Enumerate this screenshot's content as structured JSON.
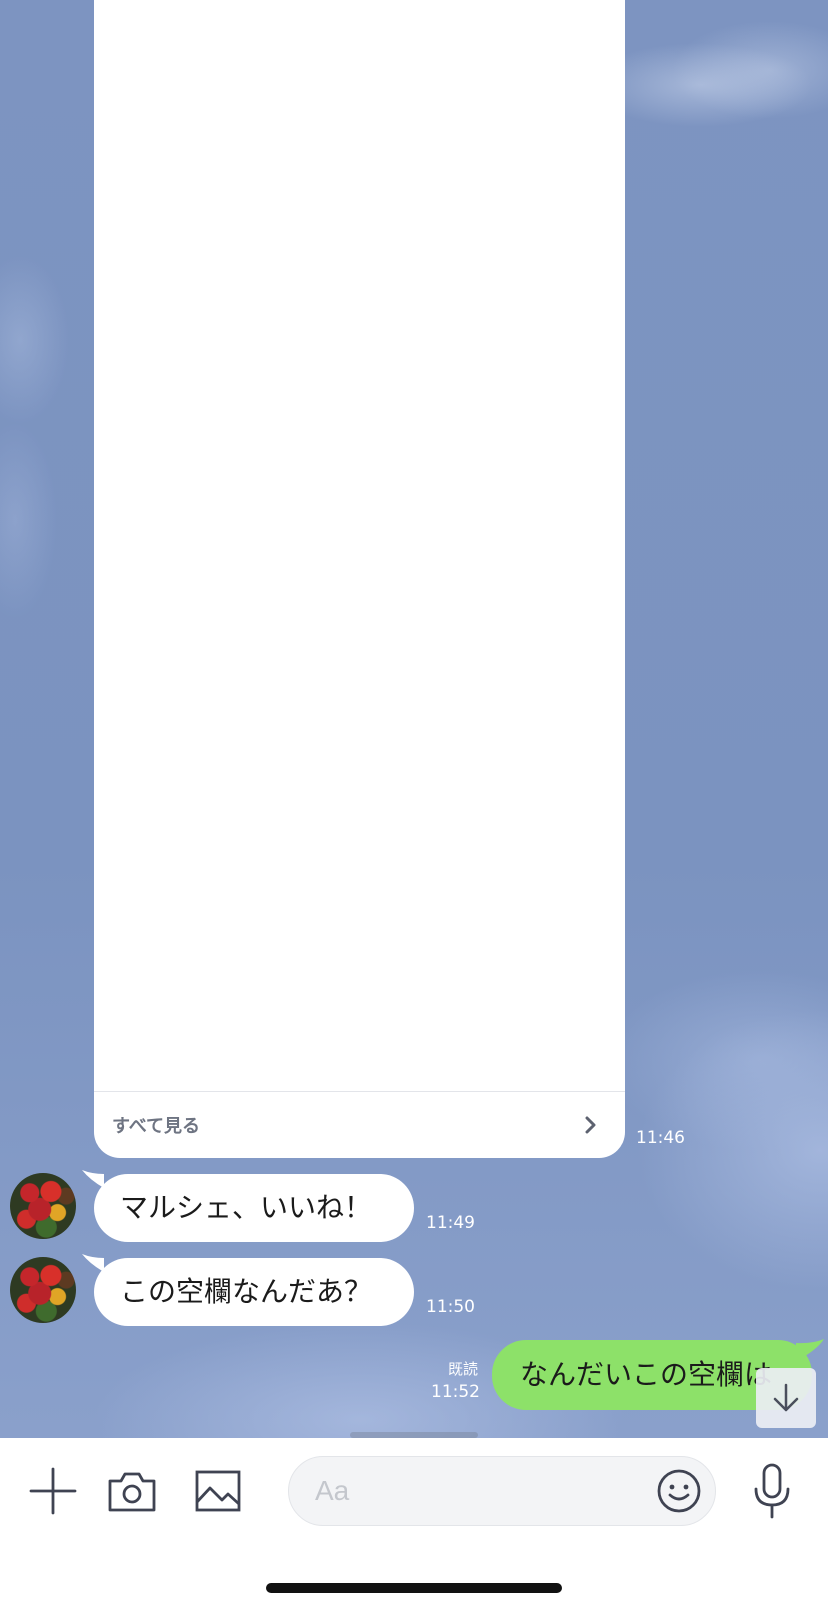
{
  "card": {
    "see_all_label": "すべて見る",
    "time": "11:46"
  },
  "messages": [
    {
      "text": "マルシェ、いいね！",
      "time": "11:49"
    },
    {
      "text": "この空欄なんだあ？",
      "time": "11:50"
    }
  ],
  "sent_message": {
    "text": "なんだいこの空欄は",
    "read_label": "既読",
    "time": "11:52"
  },
  "composer": {
    "placeholder": "Aa"
  },
  "colors": {
    "chat_background": "#7b93bf",
    "sent_bubble": "#8de169",
    "received_bubble": "#ffffff"
  },
  "icons": {
    "add": "plus-icon",
    "camera": "camera-icon",
    "gallery": "image-icon",
    "emoji": "smiley-icon",
    "voice": "microphone-icon",
    "scroll": "arrow-down-icon",
    "see_all": "chevron-right-icon"
  }
}
